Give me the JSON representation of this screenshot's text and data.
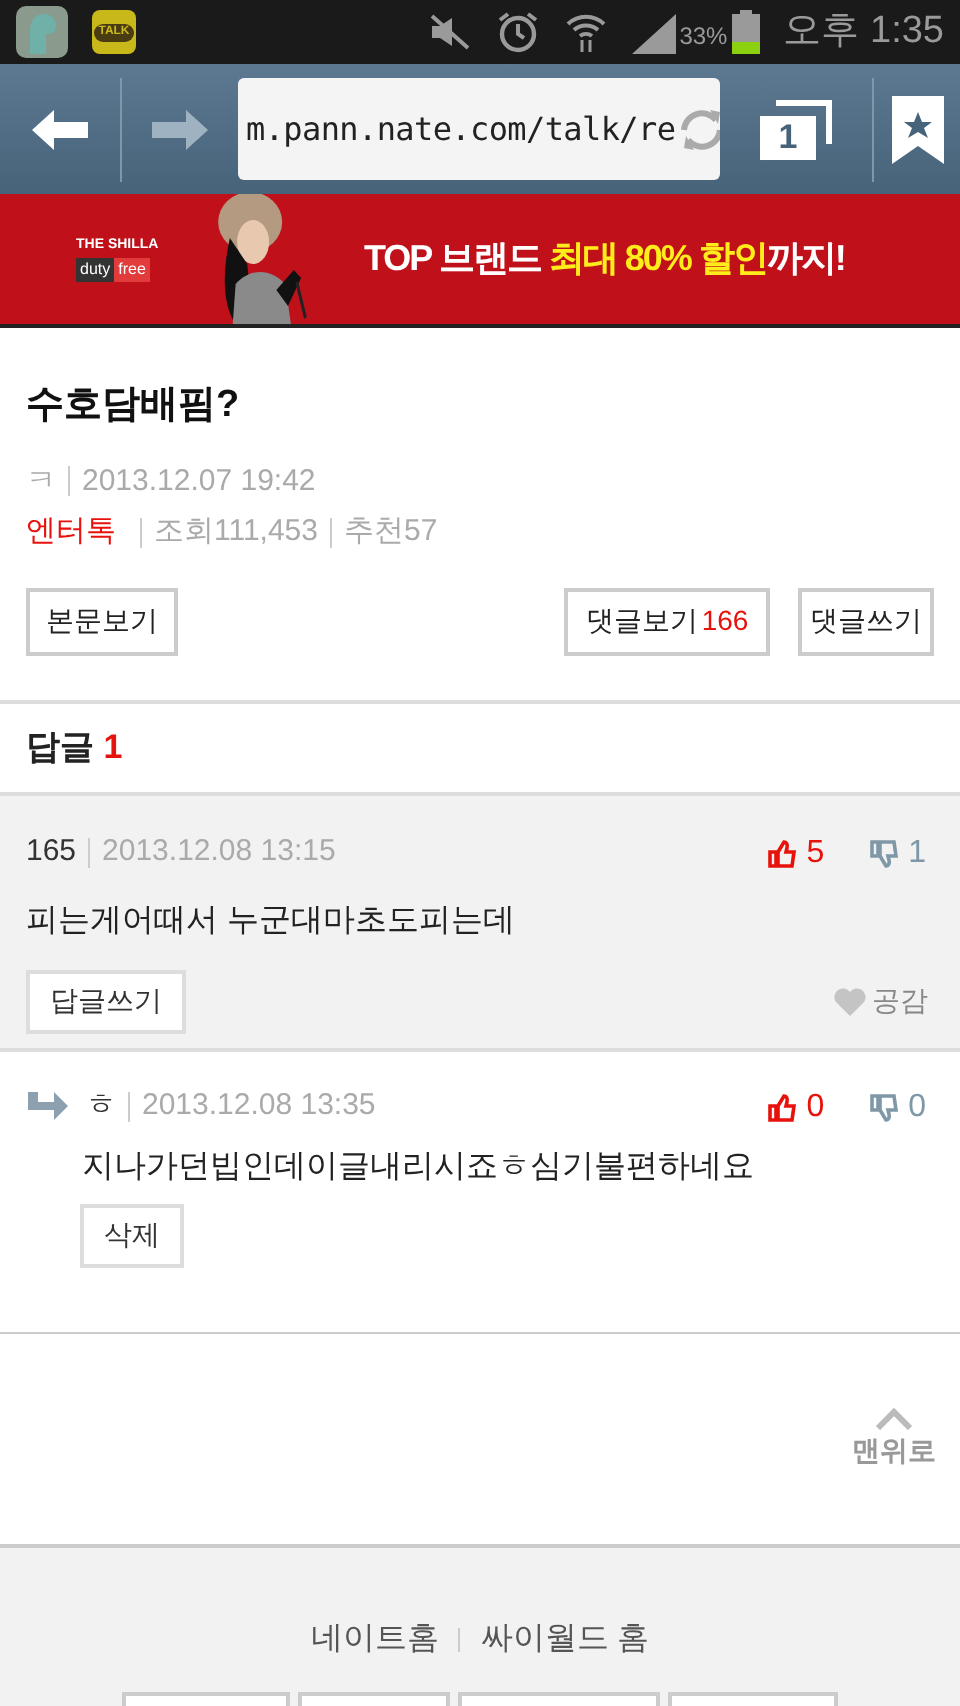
{
  "status_bar": {
    "app_badge": "TALK",
    "battery_text": "33%",
    "time": "오후 1:35"
  },
  "browser": {
    "url": "m.pann.nate.com/talk/re",
    "tab_count": "1"
  },
  "ad": {
    "brand": "THE SHILLA",
    "brand_sub": [
      "duty",
      "free"
    ],
    "headline": [
      {
        "text": "TOP 브랜드 ",
        "highlight": false
      },
      {
        "text": "최대 80% 할인",
        "highlight": true
      },
      {
        "text": "까지!",
        "highlight": false
      }
    ]
  },
  "post": {
    "title": "수호담배핌?",
    "author": "ㅋ",
    "date": "2013.12.07 19:42",
    "category": "엔터톡",
    "views": "조회111,453",
    "recommend": "추천57",
    "body_button": "본문보기",
    "comments_button": "댓글보기",
    "comments_count": "166",
    "write_button": "댓글쓰기"
  },
  "replies_header": {
    "label": "답글",
    "count": "1"
  },
  "comments": [
    {
      "kind": "comment",
      "author": "165",
      "date": "2013.12.08 13:15",
      "text": "피는게어때서 누군대마초도피는데",
      "up": "5",
      "down": "1",
      "button": "답글쓰기",
      "like": "공감"
    },
    {
      "kind": "reply",
      "author": "ㅎ",
      "date": "2013.12.08 13:35",
      "text": "지나가던빕인데이글내리시죠ㅎ심기불편하네요",
      "up": "0",
      "down": "0",
      "button": "삭제"
    }
  ],
  "top_link": "맨위로",
  "footer": {
    "links": [
      "네이트홈",
      "싸이월드 홈"
    ]
  }
}
